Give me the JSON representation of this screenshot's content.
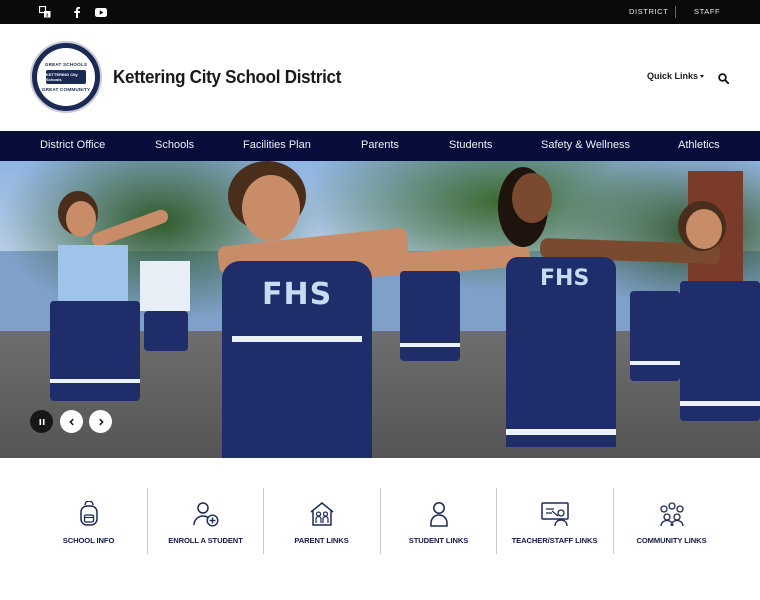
{
  "topbar": {
    "icons": [
      "translate-icon",
      "facebook-icon",
      "youtube-icon"
    ],
    "links": [
      "DISTRICT",
      "STAFF"
    ]
  },
  "header": {
    "logo": {
      "ring_top": "GREAT SCHOOLS",
      "badge": "KETTERING City Schools",
      "ring_bottom": "GREAT COMMUNITY"
    },
    "title": "Kettering City School District",
    "quick_links": "Quick Links",
    "search_icon": "search-icon"
  },
  "nav": {
    "items": [
      "District Office",
      "Schools",
      "Facilities Plan",
      "Parents",
      "Students",
      "Safety & Wellness",
      "Athletics"
    ]
  },
  "slideshow": {
    "controls": [
      "pause-icon",
      "chevron-left-icon",
      "chevron-right-icon"
    ],
    "uniform_text": "FHS"
  },
  "tiles": [
    {
      "label": "SCHOOL INFO",
      "icon": "backpack-icon"
    },
    {
      "label": "ENROLL A STUDENT",
      "icon": "add-user-icon"
    },
    {
      "label": "PARENT LINKS",
      "icon": "family-home-icon"
    },
    {
      "label": "STUDENT LINKS",
      "icon": "student-icon"
    },
    {
      "label": "TEACHER/STAFF LINKS",
      "icon": "presenter-icon"
    },
    {
      "label": "COMMUNITY LINKS",
      "icon": "community-icon"
    }
  ],
  "colors": {
    "nav_bg": "#070d3a",
    "topbar_bg": "#0a0a0a",
    "tile_label": "#111b4a"
  }
}
